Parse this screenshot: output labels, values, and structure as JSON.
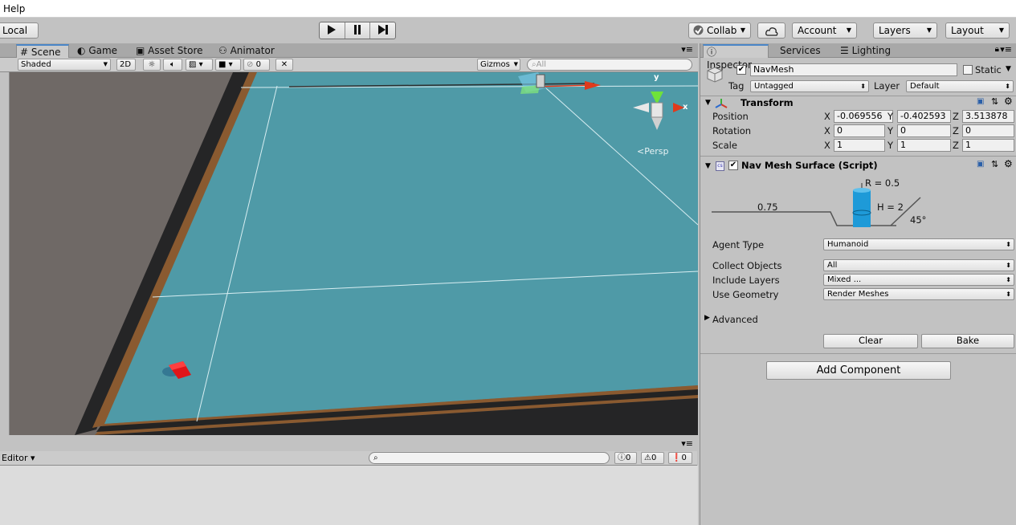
{
  "menubar": {
    "help": "Help"
  },
  "toolbar": {
    "local": "Local",
    "collab": "Collab",
    "account": "Account",
    "layers": "Layers",
    "layout": "Layout"
  },
  "scene_tabs": [
    {
      "label": "Scene",
      "icon": "hash-icon"
    },
    {
      "label": "Game",
      "icon": "pacman-icon"
    },
    {
      "label": "Asset Store",
      "icon": "bag-icon"
    },
    {
      "label": "Animator",
      "icon": "animator-icon"
    }
  ],
  "scene_bar": {
    "shaded": "Shaded",
    "mode2d": "2D",
    "effects_count": "0",
    "gizmos": "Gizmos",
    "search_placeholder": "All"
  },
  "scene_view": {
    "persp_label": "Persp",
    "gizmo_x": "x",
    "gizmo_y": "y",
    "colors": {
      "water": "#4f9aa7",
      "ground": "#6f6966",
      "wall": "#2c2b2b",
      "rim": "#8a5a30",
      "agent": "#e0161a"
    }
  },
  "console": {
    "editor": "Editor",
    "info_count": "0",
    "warn_count": "0",
    "error_count": "0"
  },
  "inspector": {
    "tabs": [
      "Inspector",
      "Services",
      "Lighting"
    ],
    "object_name": "NavMesh",
    "static_label": "Static",
    "tag_label": "Tag",
    "tag_value": "Untagged",
    "layer_label": "Layer",
    "layer_value": "Default",
    "transform": {
      "title": "Transform",
      "position_label": "Position",
      "rotation_label": "Rotation",
      "scale_label": "Scale",
      "position": {
        "x": "-0.069556",
        "y": "-0.402593",
        "z": "3.513878"
      },
      "rotation": {
        "x": "0",
        "y": "0",
        "z": "0"
      },
      "scale": {
        "x": "1",
        "y": "1",
        "z": "1"
      }
    },
    "navmesh": {
      "title": "Nav Mesh Surface (Script)",
      "radius": "R = 0.5",
      "height": "H = 2",
      "step": "0.75",
      "slope": "45°",
      "agent_type_label": "Agent Type",
      "agent_type": "Humanoid",
      "collect_label": "Collect Objects",
      "collect": "All",
      "include_label": "Include Layers",
      "include": "Mixed ...",
      "geometry_label": "Use Geometry",
      "geometry": "Render Meshes",
      "advanced": "Advanced",
      "clear": "Clear",
      "bake": "Bake"
    },
    "add_component": "Add Component"
  }
}
